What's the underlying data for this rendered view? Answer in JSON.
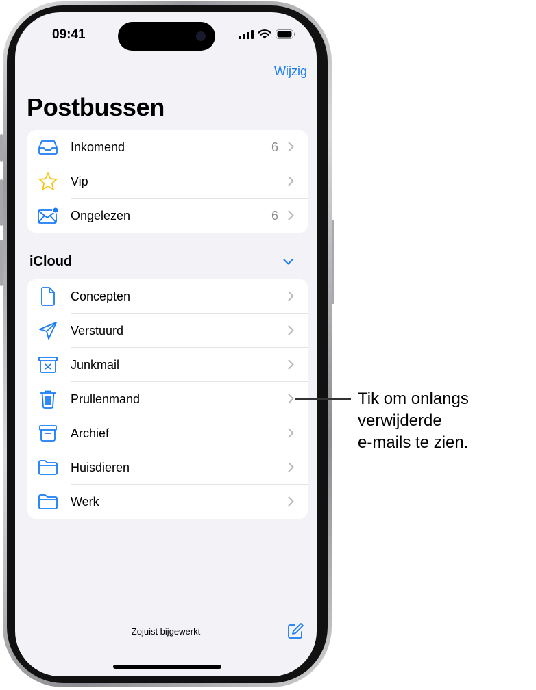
{
  "status_bar": {
    "time": "09:41"
  },
  "nav": {
    "edit_label": "Wijzig"
  },
  "page": {
    "title": "Postbussen"
  },
  "favorites": [
    {
      "label": "Inkomend",
      "count": "6",
      "icon": "inbox-icon"
    },
    {
      "label": "Vip",
      "count": "",
      "icon": "star-icon"
    },
    {
      "label": "Ongelezen",
      "count": "6",
      "icon": "unread-envelope-icon"
    }
  ],
  "icloud": {
    "header": "iCloud",
    "items": [
      {
        "label": "Concepten",
        "icon": "document-icon"
      },
      {
        "label": "Verstuurd",
        "icon": "paper-plane-icon"
      },
      {
        "label": "Junkmail",
        "icon": "junk-bin-icon"
      },
      {
        "label": "Prullenmand",
        "icon": "trash-icon"
      },
      {
        "label": "Archief",
        "icon": "archive-box-icon"
      },
      {
        "label": "Huisdieren",
        "icon": "folder-icon"
      },
      {
        "label": "Werk",
        "icon": "folder-icon"
      }
    ]
  },
  "footer": {
    "status": "Zojuist bijgewerkt"
  },
  "callout": {
    "text": "Tik om onlangs\nverwijderde\ne-mails te zien."
  },
  "colors": {
    "accent": "#1a7cf5",
    "star": "#f5c518",
    "background": "#f2f2f7"
  }
}
